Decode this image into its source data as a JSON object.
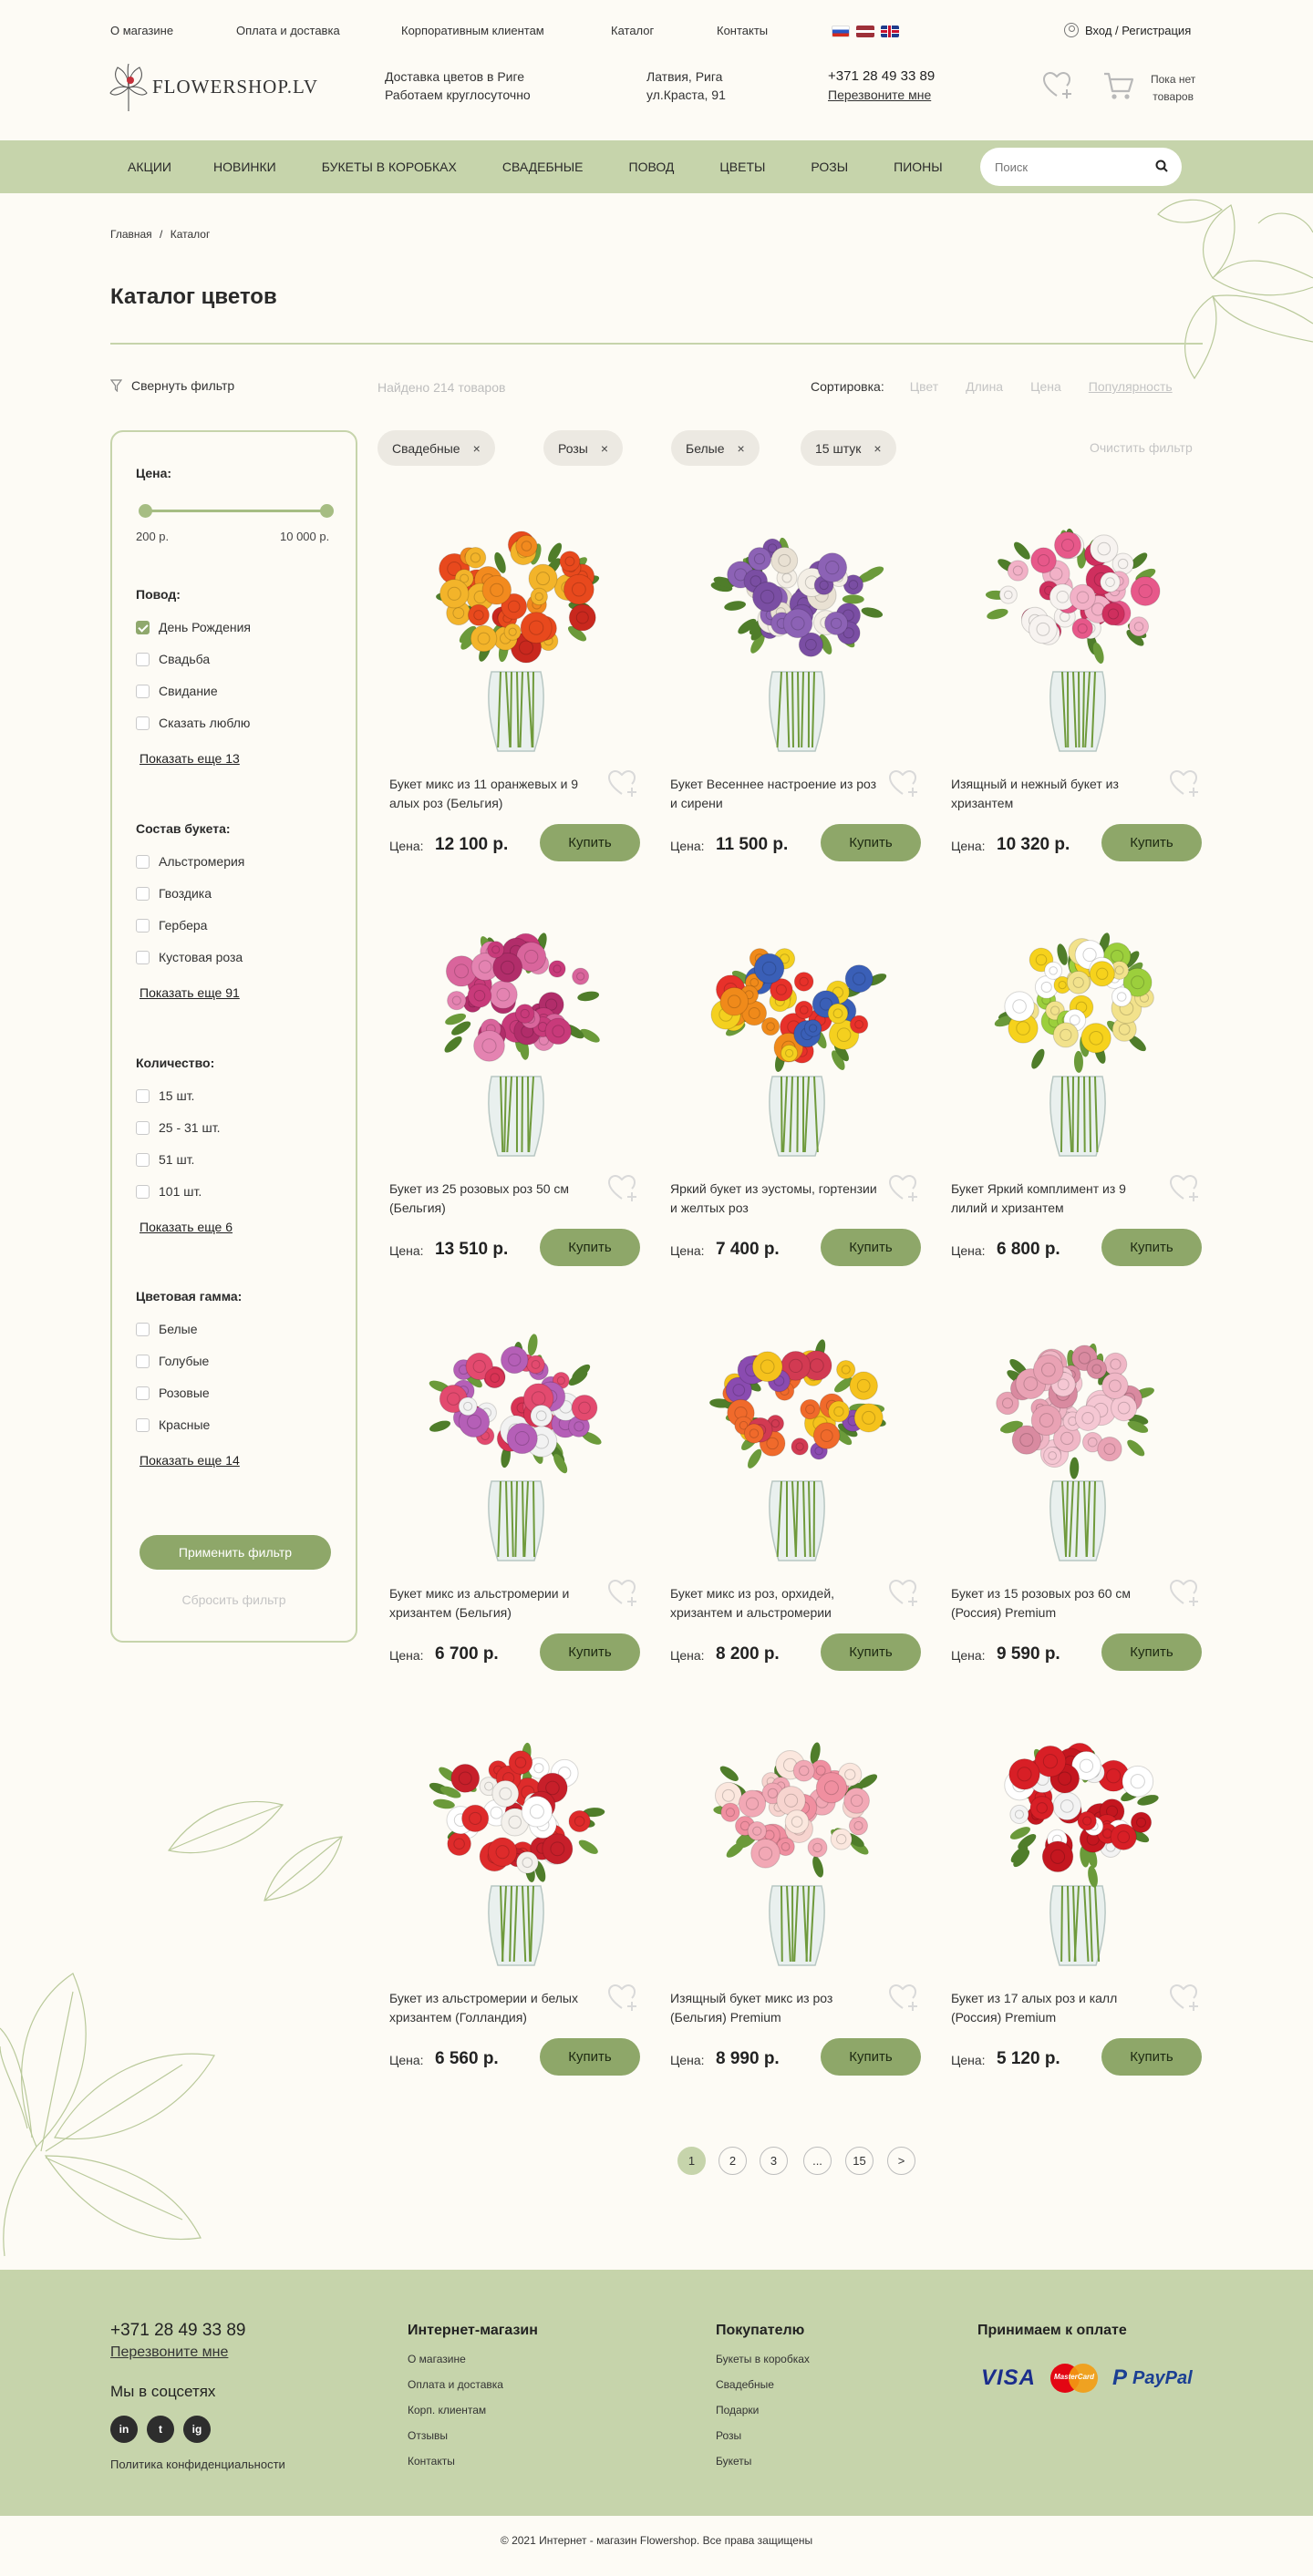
{
  "header": {
    "top_links": [
      "О магазине",
      "Оплата и доставка",
      "Корпоративным клиентам",
      "Каталог",
      "Контакты"
    ],
    "login_label": "Вход / Регистрация",
    "logo_text": "FLOWERSHOP.LV",
    "delivery_line1": "Доставка цветов в Риге",
    "delivery_line2": "Работаем круглосуточно",
    "address_line1": "Латвия, Рига",
    "address_line2": "ул.Краста, 91",
    "phone": "+371 28 49 33 89",
    "callback_label": "Перезвоните мне",
    "cart_line1": "Пока нет",
    "cart_line2": "товаров"
  },
  "nav": {
    "items": [
      "АКЦИИ",
      "НОВИНКИ",
      "БУКЕТЫ В КОРОБКАХ",
      "СВАДЕБНЫЕ",
      "ПОВОД",
      "ЦВЕТЫ",
      "РОЗЫ",
      "ПИОНЫ"
    ],
    "search_placeholder": "Поиск"
  },
  "breadcrumb": {
    "home": "Главная",
    "separator": "/",
    "current": "Каталог"
  },
  "page_title": "Каталог цветов",
  "toolbar": {
    "filter_toggle": "Свернуть фильтр",
    "found": "Найдено 214 товаров",
    "sort_label": "Сортировка:",
    "sort_options": [
      "Цвет",
      "Длина",
      "Цена",
      "Популярность"
    ]
  },
  "chips": [
    "Свадебные",
    "Розы",
    "Белые",
    "15 штук"
  ],
  "chip_close": "×",
  "clear_filter": "Очистить фильтр",
  "sidebar": {
    "price_heading": "Цена:",
    "price_min": "200 р.",
    "price_max": "10 000 р.",
    "groups": [
      {
        "heading": "Повод:",
        "options": [
          {
            "label": "День Рождения",
            "checked": true
          },
          {
            "label": "Свадьба",
            "checked": false
          },
          {
            "label": "Свидание",
            "checked": false
          },
          {
            "label": "Сказать люблю",
            "checked": false
          }
        ],
        "more": "Показать еще 13"
      },
      {
        "heading": "Состав букета:",
        "options": [
          {
            "label": "Альстромерия",
            "checked": false
          },
          {
            "label": "Гвоздика",
            "checked": false
          },
          {
            "label": "Гербера",
            "checked": false
          },
          {
            "label": "Кустовая роза",
            "checked": false
          }
        ],
        "more": "Показать еще 91"
      },
      {
        "heading": "Количество:",
        "options": [
          {
            "label": "15 шт.",
            "checked": false
          },
          {
            "label": "25 - 31 шт.",
            "checked": false
          },
          {
            "label": "51 шт.",
            "checked": false
          },
          {
            "label": "101 шт.",
            "checked": false
          }
        ],
        "more": "Показать еще 6"
      },
      {
        "heading": "Цветовая гамма:",
        "options": [
          {
            "label": "Белые",
            "checked": false
          },
          {
            "label": "Голубые",
            "checked": false
          },
          {
            "label": "Розовые",
            "checked": false
          },
          {
            "label": "Красные",
            "checked": false
          }
        ],
        "more": "Показать еще 14"
      }
    ],
    "apply_label": "Применить фильтр",
    "reset_label": "Сбросить фильтр"
  },
  "products": [
    {
      "name": "Букет микс из 11 оранжевых и 9 алых роз (Бельгия)",
      "price": "12 100 р.",
      "palette": [
        "#e8491d",
        "#f28a1e",
        "#f3b42a",
        "#c9281e"
      ]
    },
    {
      "name": "Букет Весеннее настроение из роз и сирени",
      "price": "11 500 р.",
      "palette": [
        "#f4efe6",
        "#8c62b5",
        "#e9e1d3",
        "#7a4ea3"
      ]
    },
    {
      "name": "Изящный и нежный букет из хризантем",
      "price": "10 320 р.",
      "palette": [
        "#e7588a",
        "#f7f3f0",
        "#cf2f5e",
        "#f2b1c7"
      ]
    },
    {
      "name": "Букет из 25 розовых роз 50 см (Бельгия)",
      "price": "13 510 р.",
      "palette": [
        "#c83a7a",
        "#d9659c",
        "#b12d6a",
        "#e483b1"
      ]
    },
    {
      "name": "Яркий букет из эустомы, гортензии и желтых роз",
      "price": "7 400 р.",
      "palette": [
        "#e7312a",
        "#f4d01f",
        "#3a5fb7",
        "#f08a1a"
      ]
    },
    {
      "name": "Букет Яркий комплимент из 9 лилий и хризантем",
      "price": "6 800 р.",
      "palette": [
        "#f6d21c",
        "#ffffff",
        "#f2e28c",
        "#9ccf3c"
      ]
    },
    {
      "name": "Букет микс из альстромерии и хризантем (Бельгия)",
      "price": "6 700 р.",
      "palette": [
        "#d93355",
        "#b55fb7",
        "#f2f2f2",
        "#e34a6f"
      ]
    },
    {
      "name": "Букет микс из роз, орхидей, хризантем и альстромерии",
      "price": "8 200 р.",
      "palette": [
        "#f06a2b",
        "#f5c21c",
        "#d23a52",
        "#8a4bb0"
      ]
    },
    {
      "name": "Букет из 15 розовых роз 60 см (Россия) Premium",
      "price": "9 590 р.",
      "palette": [
        "#e9a2b4",
        "#f0b7c6",
        "#d98aa0",
        "#f5c7d3"
      ]
    },
    {
      "name": "Букет из альстромерии и белых хризантем (Голландия)",
      "price": "6 560 р.",
      "palette": [
        "#de2b2b",
        "#ffffff",
        "#f4f1ec",
        "#c71f2a"
      ]
    },
    {
      "name": "Изящный букет микс из роз (Бельгия) Premium",
      "price": "8 990 р.",
      "palette": [
        "#f2a8b5",
        "#f7d4cf",
        "#f08fa0",
        "#fbe7de"
      ]
    },
    {
      "name": "Букет из 17 алых роз и калл (Россия) Premium",
      "price": "5 120 р.",
      "palette": [
        "#d81f26",
        "#ffffff",
        "#c4161f",
        "#f3f3f3"
      ]
    }
  ],
  "product_labels": {
    "price_label": "Цена:",
    "buy_label": "Купить"
  },
  "pagination": [
    "1",
    "2",
    "3",
    "...",
    "15",
    ">"
  ],
  "footer": {
    "phone": "+371 28 49 33 89",
    "callback": "Перезвоните мне",
    "social_title": "Мы в соцсетях",
    "social": [
      "in",
      "t",
      "ig"
    ],
    "privacy": "Политика конфиденциальности",
    "shop_title": "Интернет-магазин",
    "shop_items": [
      "О магазине",
      "Оплата и доставка",
      "Корп. клиентам",
      "Отзывы",
      "Контакты"
    ],
    "buyer_title": "Покупателю",
    "buyer_items": [
      "Букеты в коробках",
      "Свадебные",
      "Подарки",
      "Розы",
      "Букеты"
    ],
    "payment_title": "Принимаем к оплате",
    "payment_visa": "VISA",
    "payment_mc": "MasterCard",
    "payment_paypal": "PayPal"
  },
  "copyright": "© 2021 Интернет - магазин Flowershop. Все права защищены",
  "colors": {
    "accent_green": "#8ea769",
    "nav_green": "#c6d4ab",
    "background": "#fdfbf5"
  }
}
